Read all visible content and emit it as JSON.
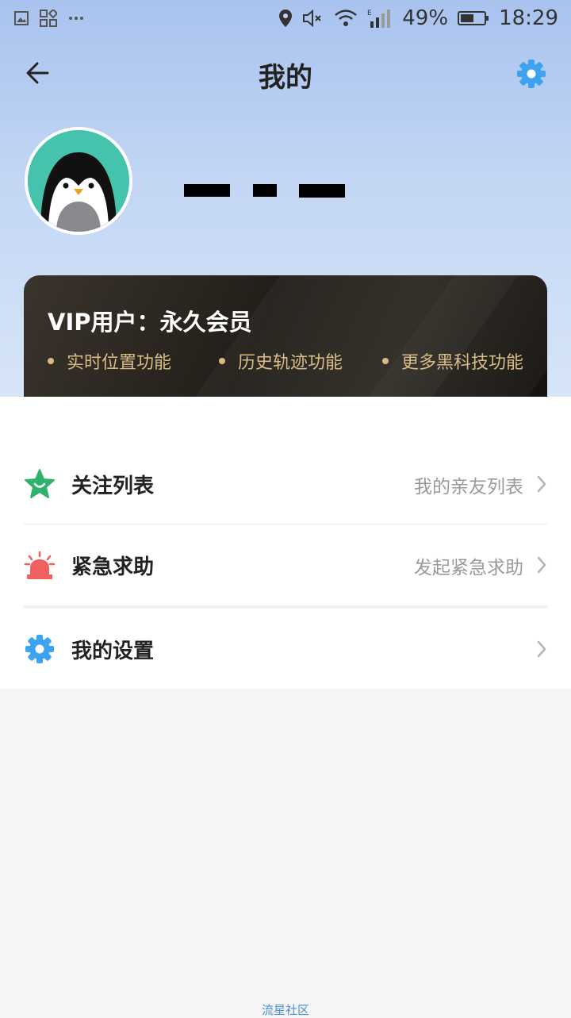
{
  "status_bar": {
    "battery_pct": "49%",
    "time": "18:29"
  },
  "nav": {
    "title": "我的"
  },
  "vip": {
    "title": "VIP用户：永久会员",
    "features": [
      "实时位置功能",
      "历史轨迹功能",
      "更多黑科技功能"
    ]
  },
  "menu": [
    {
      "label": "关注列表",
      "sub": "我的亲友列表",
      "icon": "star-face-icon"
    },
    {
      "label": "紧急求助",
      "sub": "发起紧急求助",
      "icon": "alarm-siren-icon"
    },
    {
      "label": "我的设置",
      "sub": "",
      "icon": "gear-icon"
    }
  ],
  "footer": {
    "text": "流星社区"
  },
  "colors": {
    "accent_blue": "#3da2f0",
    "vip_gold": "#d9bc85",
    "star_green": "#2fb36a",
    "alarm_red": "#f06060"
  }
}
